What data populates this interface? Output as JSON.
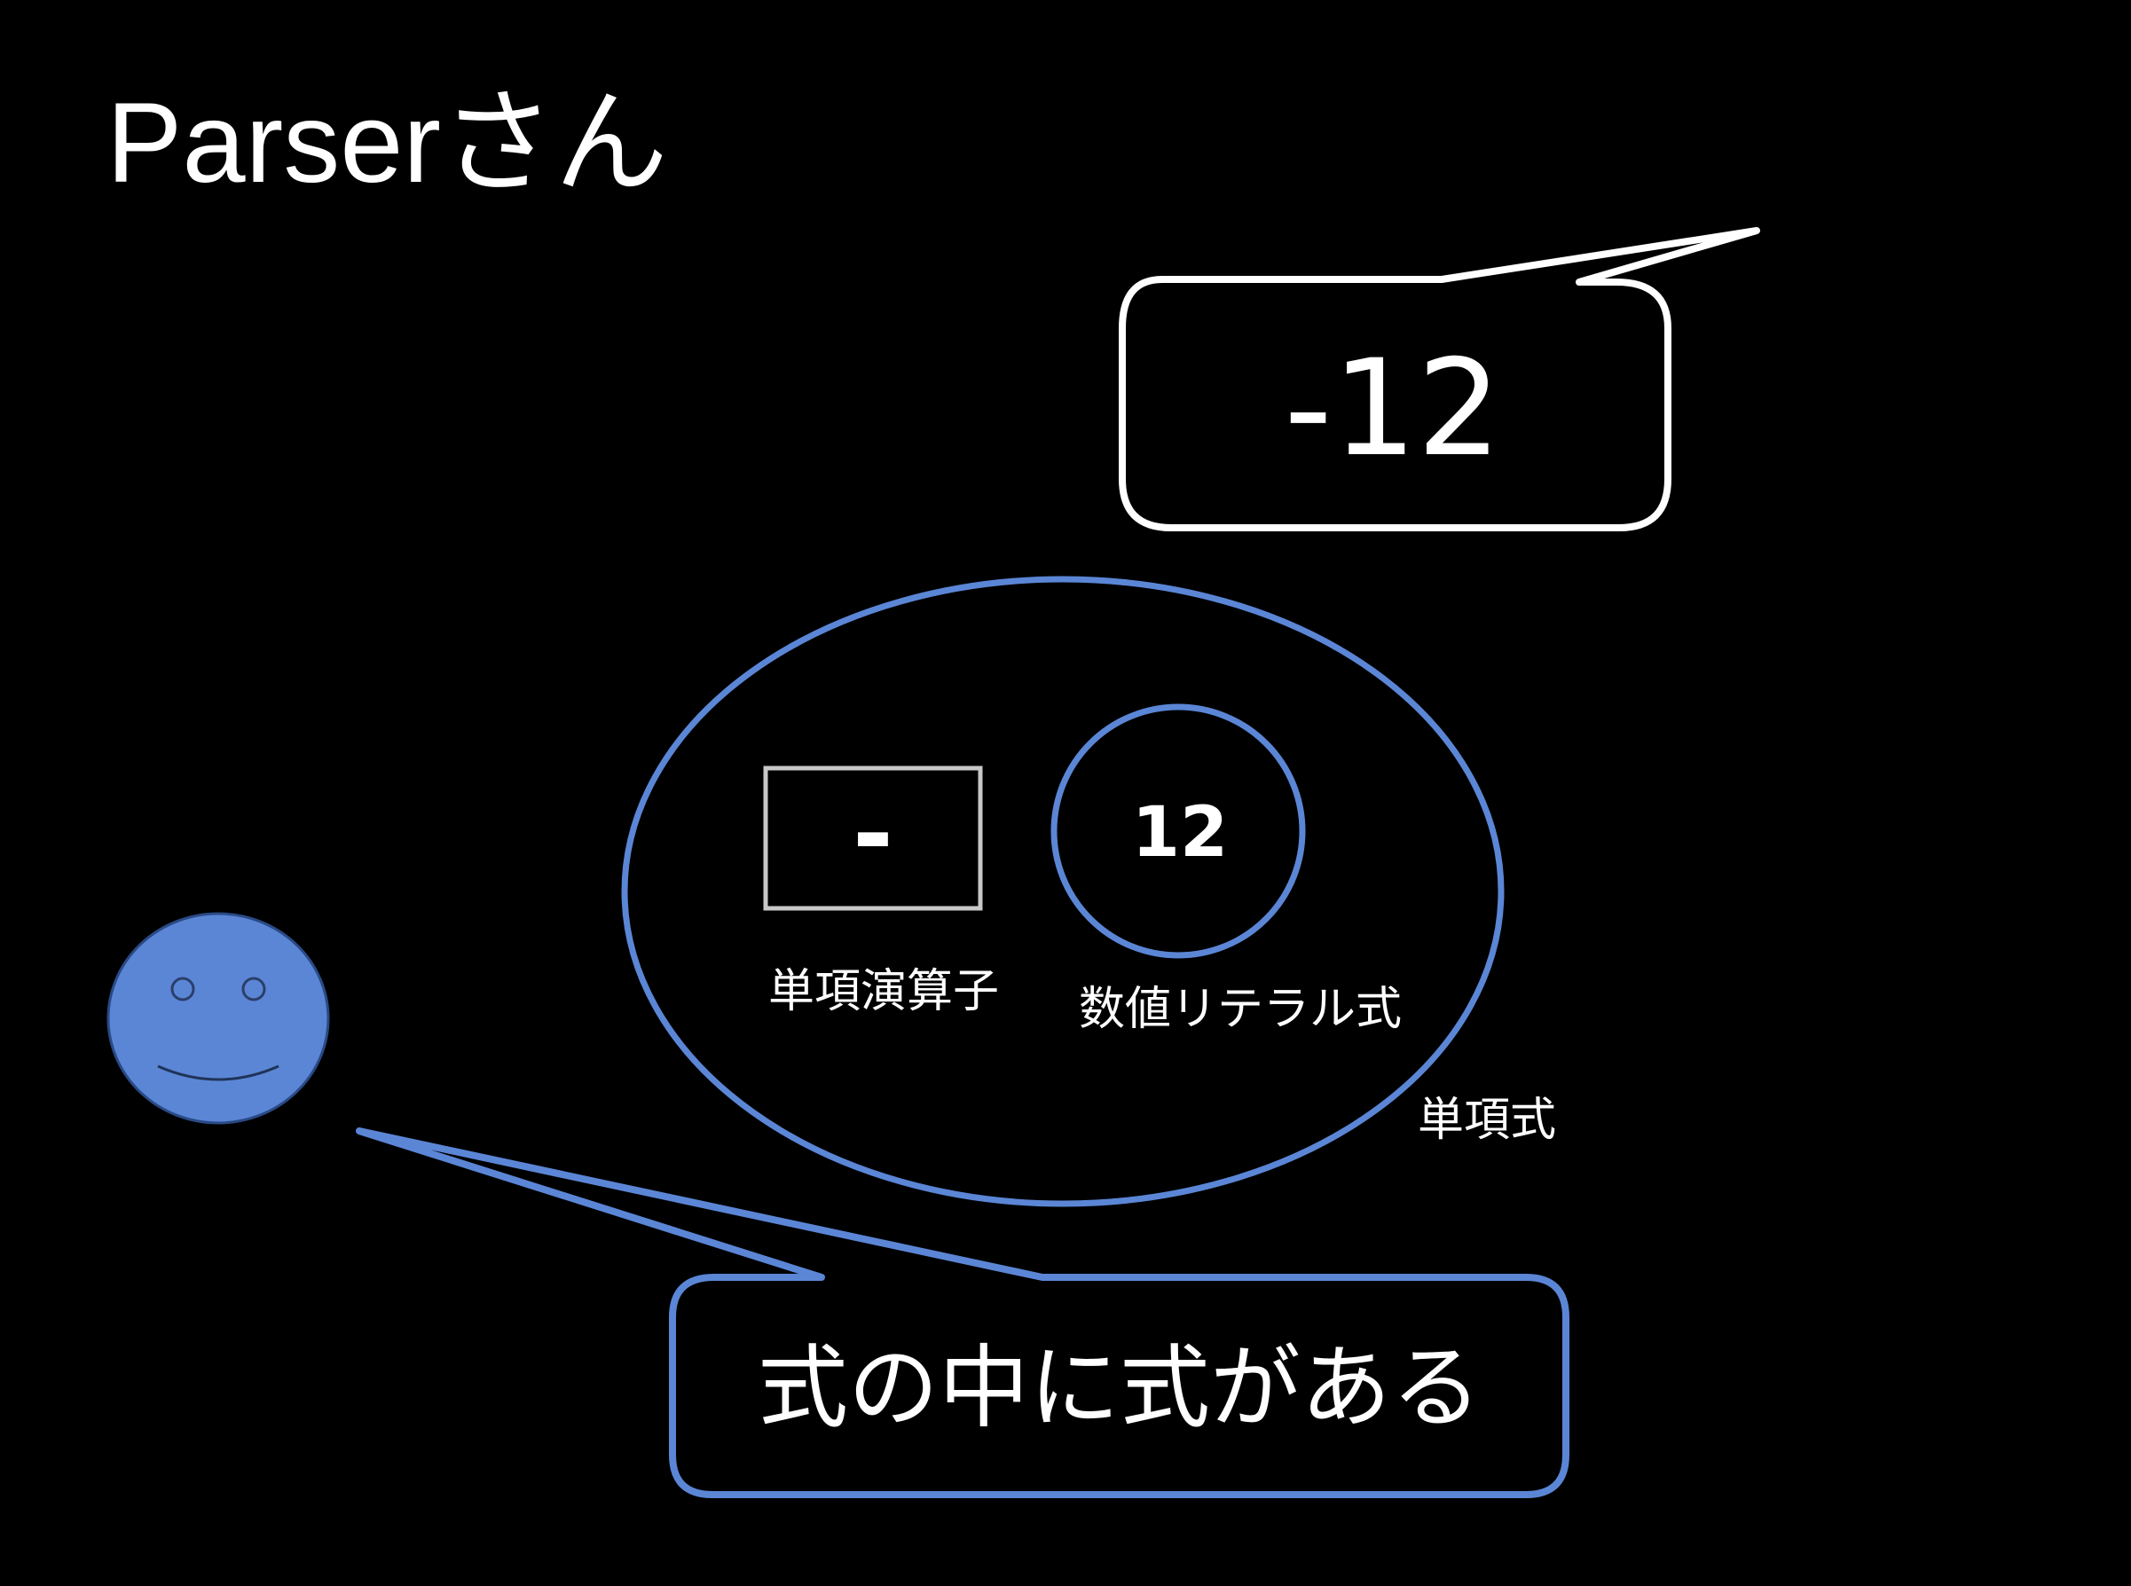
{
  "slide": {
    "title": "Parserさん",
    "top_bubble": {
      "text": "-12"
    },
    "ast": {
      "unary_operator": {
        "symbol": "-",
        "label": "単項演算子"
      },
      "numeric_literal": {
        "value": "12",
        "label": "数値リテラル式"
      },
      "unary_expression_label": "単項式"
    },
    "character": {
      "name": "smiley-face"
    },
    "bottom_bubble": {
      "text": "式の中に式がある"
    }
  },
  "colors": {
    "background": "#000000",
    "accent_blue": "#5b86d6",
    "face_fill": "#5b86d6",
    "white": "#ffffff",
    "operator_box_border": "#c8c8c8"
  }
}
